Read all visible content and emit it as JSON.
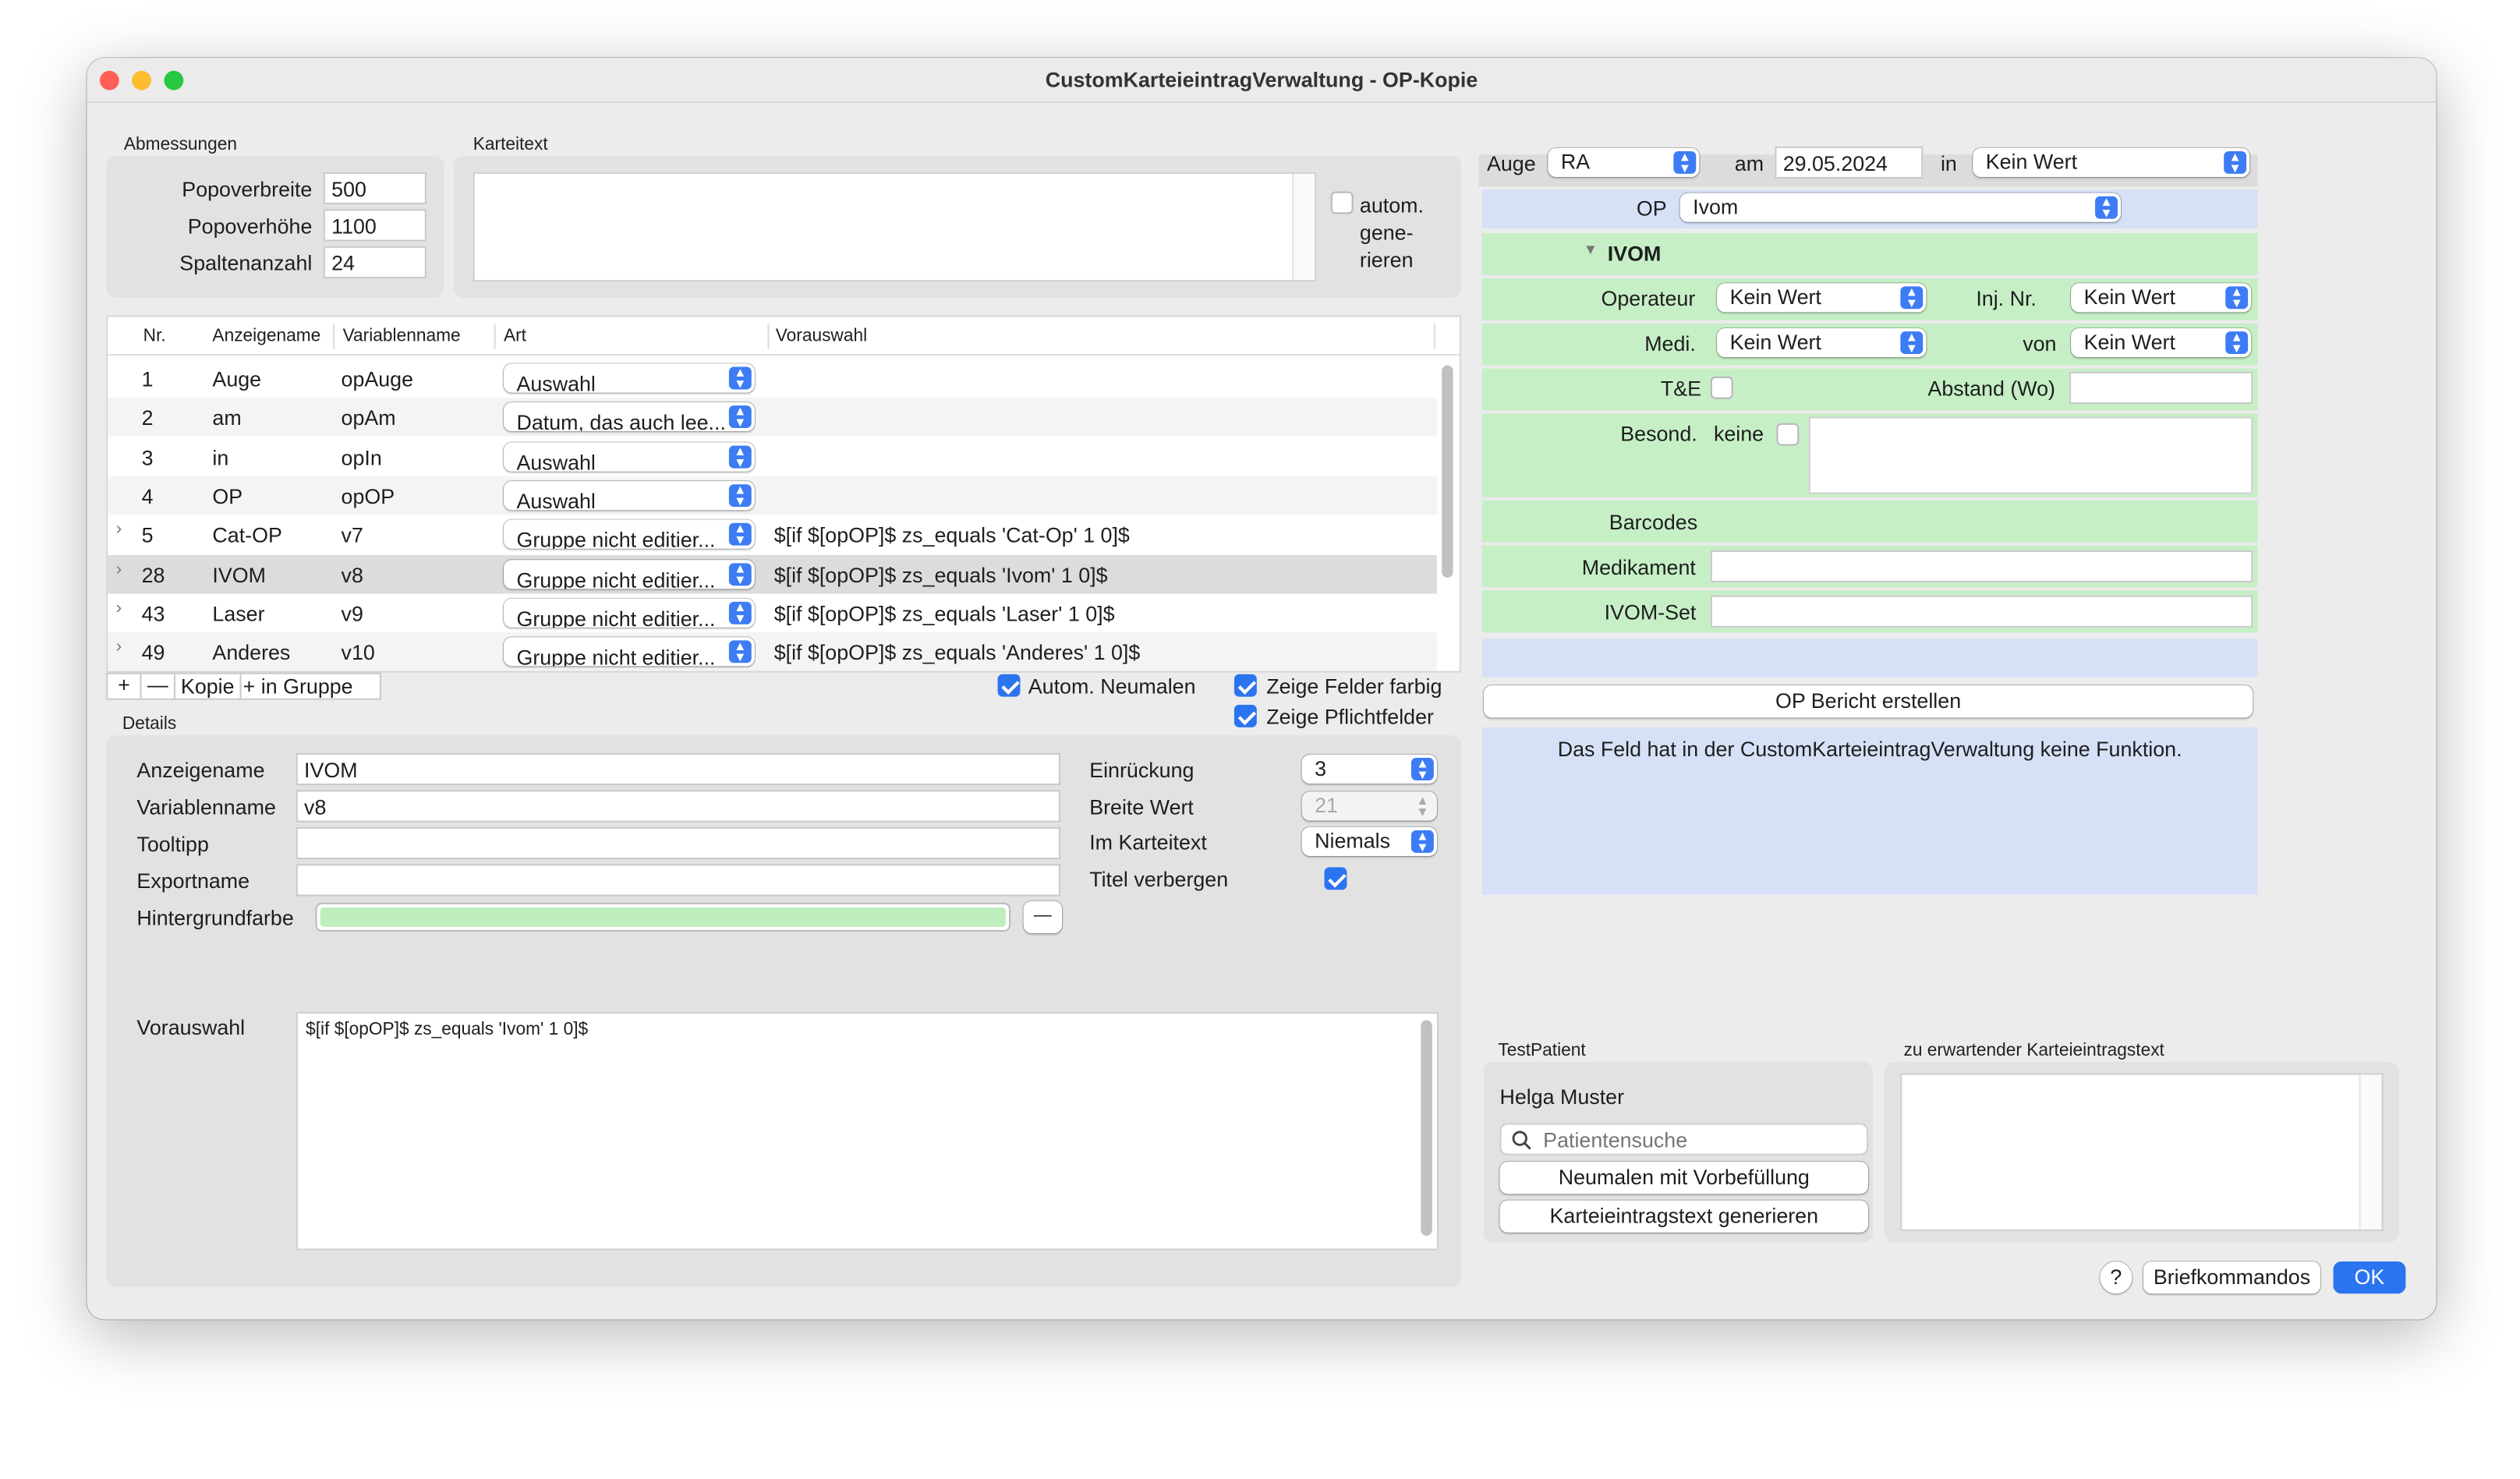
{
  "window": {
    "title": "CustomKarteieintragVerwaltung - OP-Kopie"
  },
  "abmessungen": {
    "label": "Abmessungen",
    "breite_label": "Popoverbreite",
    "breite": "500",
    "hoehe_label": "Popoverhöhe",
    "hoehe": "1100",
    "spalten_label": "Spaltenanzahl",
    "spalten": "24"
  },
  "karteitext": {
    "label": "Karteitext",
    "autom_line1": "autom.",
    "autom_line2": "gene-",
    "autom_line3": "rieren"
  },
  "table": {
    "headers": [
      "Nr.",
      "Anzeigename",
      "Variablenname",
      "Art",
      "Vorauswahl"
    ],
    "rows": [
      {
        "nr": "1",
        "name": "Auge",
        "var": "opAuge",
        "art": "Auswahl",
        "vor": ""
      },
      {
        "nr": "2",
        "name": "am",
        "var": "opAm",
        "art": "Datum, das auch lee...",
        "vor": ""
      },
      {
        "nr": "3",
        "name": "in",
        "var": "opIn",
        "art": "Auswahl",
        "vor": ""
      },
      {
        "nr": "4",
        "name": "OP",
        "var": "opOP",
        "art": "Auswahl",
        "vor": ""
      },
      {
        "nr": "5",
        "name": "Cat-OP",
        "var": "v7",
        "art": "Gruppe nicht editier...",
        "vor": "$[if $[opOP]$ zs_equals 'Cat-Op' 1 0]$"
      },
      {
        "nr": "28",
        "name": "IVOM",
        "var": "v8",
        "art": "Gruppe nicht editier...",
        "vor": "$[if $[opOP]$ zs_equals 'Ivom' 1 0]$"
      },
      {
        "nr": "43",
        "name": "Laser",
        "var": "v9",
        "art": "Gruppe nicht editier...",
        "vor": "$[if $[opOP]$ zs_equals 'Laser' 1 0]$"
      },
      {
        "nr": "49",
        "name": "Anderes",
        "var": "v10",
        "art": "Gruppe nicht editier...",
        "vor": "$[if $[opOP]$ zs_equals 'Anderes' 1 0]$"
      }
    ]
  },
  "toolbar": {
    "add": "+",
    "remove": "—",
    "kopie": "Kopie",
    "in_gruppe": "+ in Gruppe",
    "autom_neumalen": "Autom. Neumalen",
    "zeige_farbig": "Zeige Felder farbig",
    "zeige_pflicht": "Zeige Pflichtfelder"
  },
  "details": {
    "label": "Details",
    "anzeigename_label": "Anzeigename",
    "anzeigename": "IVOM",
    "variablenname_label": "Variablenname",
    "variablenname": "v8",
    "tooltipp_label": "Tooltipp",
    "tooltipp": "",
    "exportname_label": "Exportname",
    "exportname": "",
    "hintergrund_label": "Hintergrundfarbe",
    "hintergrund_color": "#bdeebb",
    "einrueckung_label": "Einrückung",
    "einrueckung": "3",
    "breite_label": "Breite Wert",
    "breite": "21",
    "karteitext_label": "Im Karteitext",
    "karteitext": "Niemals",
    "titel_label": "Titel verbergen",
    "vorauswahl_label": "Vorauswahl",
    "vorauswahl": "$[if $[opOP]$ zs_equals 'Ivom' 1 0]$",
    "minus": "—"
  },
  "preview": {
    "auge_label": "Auge",
    "auge": "RA",
    "am_label": "am",
    "am": "29.05.2024",
    "in_label": "in",
    "in": "Kein Wert",
    "op_label": "OP",
    "op": "Ivom",
    "ivom_title": "IVOM",
    "operateur_label": "Operateur",
    "operateur": "Kein Wert",
    "injnr_label": "Inj. Nr.",
    "injnr": "Kein Wert",
    "medi_label": "Medi.",
    "medi": "Kein Wert",
    "von_label": "von",
    "von": "Kein Wert",
    "te_label": "T&E",
    "abstand_label": "Abstand (Wo)",
    "besond_label": "Besond.",
    "keine_label": "keine",
    "barcodes_label": "Barcodes",
    "medikament_label": "Medikament",
    "ivomset_label": "IVOM-Set",
    "bericht_button": "OP Bericht erstellen",
    "info_text": "Das Feld hat in der CustomKarteieintragVerwaltung keine Funktion."
  },
  "testpatient": {
    "label": "TestPatient",
    "name": "Helga Muster",
    "search_placeholder": "Patientensuche",
    "neumalen_button": "Neumalen mit Vorbefüllung",
    "generieren_button": "Karteieintragstext generieren",
    "expected_label": "zu erwartender Karteieintragstext"
  },
  "footer": {
    "help": "?",
    "briefkommandos": "Briefkommandos",
    "ok": "OK"
  },
  "colors": {
    "accent": "#2b74f0",
    "green_panel": "#c6efc6",
    "blue_panel": "#d6e1f7"
  }
}
